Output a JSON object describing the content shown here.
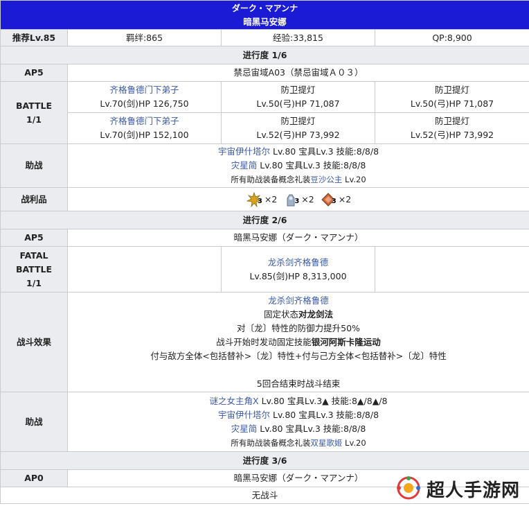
{
  "header": {
    "title": "ダーク・マアンナ",
    "subtitle": "暗黑马安娜"
  },
  "info": {
    "rec": "推荐Lv.85",
    "bond": "羁绊:865",
    "exp": "经验:33,815",
    "qp": "QP:8,900"
  },
  "p1": {
    "title": "进行度 1/6",
    "ap_label": "AP5",
    "ap_value": "禁忌宙域A03（禁忌宙域Ａ０３）",
    "battle_label": "BATTLE\n1/1",
    "enemies": [
      {
        "name": "齐格鲁德门下弟子",
        "stat": "Lv.70(剑)HP 126,750"
      },
      {
        "name": "防卫提灯",
        "stat": "Lv.50(弓)HP 71,087"
      },
      {
        "name": "防卫提灯",
        "stat": "Lv.50(弓)HP 71,087"
      },
      {
        "name": "齐格鲁德门下弟子",
        "stat": "Lv.70(剑)HP 152,100"
      },
      {
        "name": "防卫提灯",
        "stat": "Lv.52(弓)HP 73,992"
      },
      {
        "name": "防卫提灯",
        "stat": "Lv.52(弓)HP 73,992"
      }
    ],
    "support_label": "助战",
    "support": {
      "l1_name": "宇宙伊什塔尔",
      "l1_rest": " Lv.80 宝具Lv.3 技能:8/8/8",
      "l2_name": "灾星简",
      "l2_rest": " Lv.80 宝具Lv.3 技能:8/8/8",
      "l3_pre": "所有助战装备概念礼装",
      "l3_name": "豆沙公主",
      "l3_post": " Lv.20"
    },
    "drops_label": "战利品",
    "drops": [
      {
        "icon": "gold-gear-icon",
        "count": "3",
        "qty": "×2"
      },
      {
        "icon": "silver-statue-icon",
        "count": "3",
        "qty": "×2"
      },
      {
        "icon": "bronze-gem-icon",
        "count": "3",
        "qty": "×2"
      }
    ]
  },
  "p2": {
    "title": "进行度 2/6",
    "ap_label": "AP5",
    "ap_value": "暗黑马安娜（ダーク・マアンナ）",
    "battle_label": "FATAL\nBATTLE\n1/1",
    "boss_name": "龙杀剑齐格鲁德",
    "boss_stat": "Lv.85(剑)HP 8,313,000",
    "effect_label": "战斗效果",
    "effect": {
      "name": "龙杀剑齐格鲁德",
      "l2_pre": "固定状态",
      "l2_bold": "对龙剑法",
      "l3": "对〔龙〕特性的防御力提升50%",
      "l4_pre": "战斗开始时发动固定技能",
      "l4_bold": "银河阿斯卡隆运动",
      "l5": "付与敌方全体<包括替补>〔龙〕特性+付与己方全体<包括替补>〔龙〕特性",
      "l6": "5回合结束时战斗结束"
    },
    "support_label": "助战",
    "support": {
      "l1_name": "谜之女主角X",
      "l1_rest": " Lv.80 宝具Lv.3▲ 技能:8▲/8▲/8",
      "l2_name": "宇宙伊什塔尔",
      "l2_rest": " Lv.80 宝具Lv.3 技能:8/8/8",
      "l3_name": "灾星简",
      "l3_rest": " Lv.80 宝具Lv.3 技能:8/8/8",
      "l4_pre": "所有助战装备概念礼装",
      "l4_name": "双星歌姬",
      "l4_post": " Lv.20"
    }
  },
  "p3": {
    "title": "进行度 3/6",
    "ap_label": "AP0",
    "ap_value": "暗黑马安娜（ダーク・マアンナ）",
    "no_battle": "无战斗"
  },
  "watermark": {
    "text": "超人手游网"
  },
  "colors": {
    "title_bg": "#1b1bd6",
    "link": "#3a5aa8",
    "header_bg": "#eaecf0",
    "border": "#c8ccd1"
  }
}
